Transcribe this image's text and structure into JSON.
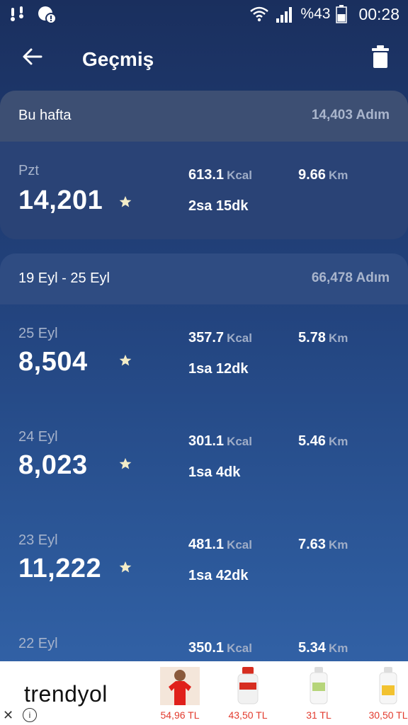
{
  "status": {
    "battery": "%43",
    "time": "00:28"
  },
  "appbar": {
    "title": "Geçmiş"
  },
  "this_week": {
    "label": "Bu hafta",
    "total": "14,403 Adım",
    "days": [
      {
        "label": "Pzt",
        "steps": "14,201",
        "kcal": "613.1",
        "km": "9.66",
        "duration": "2sa 15dk"
      }
    ]
  },
  "prev_week": {
    "label": "19 Eyl - 25 Eyl",
    "total": "66,478 Adım",
    "days": [
      {
        "label": "25 Eyl",
        "steps": "8,504",
        "kcal": "357.7",
        "km": "5.78",
        "duration": "1sa 12dk"
      },
      {
        "label": "24 Eyl",
        "steps": "8,023",
        "kcal": "301.1",
        "km": "5.46",
        "duration": "1sa 4dk"
      },
      {
        "label": "23 Eyl",
        "steps": "11,222",
        "kcal": "481.1",
        "km": "7.63",
        "duration": "1sa 42dk"
      },
      {
        "label": "22 Eyl",
        "kcal": "350.1",
        "km": "5.34"
      }
    ]
  },
  "units": {
    "kcal": "Kcal",
    "km": "Km"
  },
  "ad": {
    "brand": "trendyol",
    "items": [
      {
        "price": "54,96 TL"
      },
      {
        "price": "43,50 TL"
      },
      {
        "price": "31 TL"
      },
      {
        "price": "30,50 TL"
      }
    ]
  },
  "colors": {
    "bg_top": "#1a2f5e",
    "bg_bottom": "#3566ac",
    "muted": "#a6b3cb",
    "star": "#f3ecc8",
    "price": "#e23b2e"
  },
  "icons": [
    "back-arrow-icon",
    "trash-icon",
    "star-icon",
    "wifi-icon",
    "signal-icon",
    "battery-icon",
    "close-icon",
    "info-icon"
  ]
}
